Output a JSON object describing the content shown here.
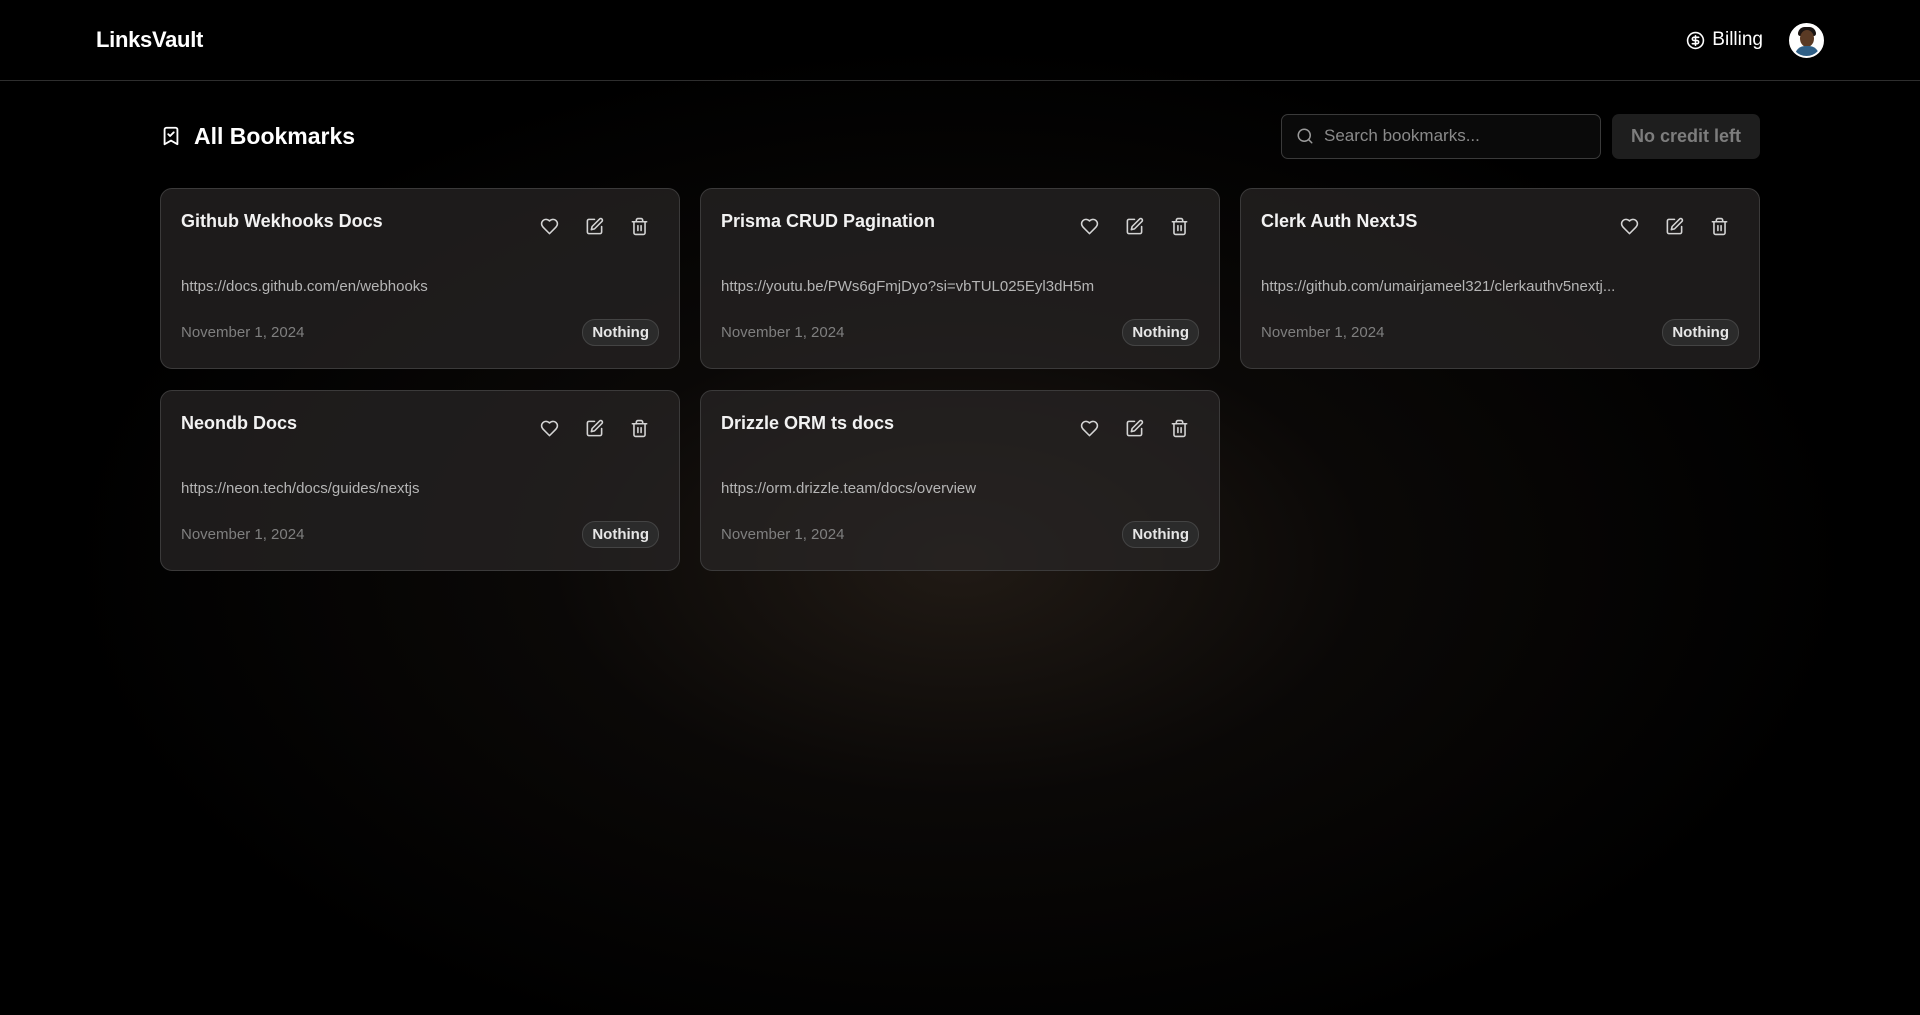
{
  "app": {
    "brand": "LinksVault"
  },
  "nav": {
    "billing_label": "Billing",
    "billing_icon": "dollar-circle-icon",
    "avatar": "user-avatar"
  },
  "toolbar": {
    "title": "All Bookmarks",
    "title_icon": "bookmark-icon",
    "search_placeholder": "Search bookmarks...",
    "search_value": "",
    "credit_label": "No credit left"
  },
  "bookmarks": [
    {
      "title": "Github Wekhooks Docs",
      "url": "https://docs.github.com/en/webhooks",
      "date": "November 1, 2024",
      "tag": "Nothing"
    },
    {
      "title": "Prisma CRUD Pagination",
      "url": "https://youtu.be/PWs6gFmjDyo?si=vbTUL025Eyl3dH5m",
      "date": "November 1, 2024",
      "tag": "Nothing"
    },
    {
      "title": "Clerk Auth NextJS",
      "url": "https://github.com/umairjameel321/clerkauthv5nextj...",
      "date": "November 1, 2024",
      "tag": "Nothing"
    },
    {
      "title": "Neondb Docs",
      "url": "https://neon.tech/docs/guides/nextjs",
      "date": "November 1, 2024",
      "tag": "Nothing"
    },
    {
      "title": "Drizzle ORM ts docs",
      "url": "https://orm.drizzle.team/docs/overview",
      "date": "November 1, 2024",
      "tag": "Nothing"
    }
  ],
  "card_icons": [
    "heart-icon",
    "edit-icon",
    "trash-icon"
  ],
  "colors": {
    "background": "#000000",
    "card_bg": "#282626",
    "card_border": "#3b3a3a",
    "accent_text": "#ffffff"
  }
}
